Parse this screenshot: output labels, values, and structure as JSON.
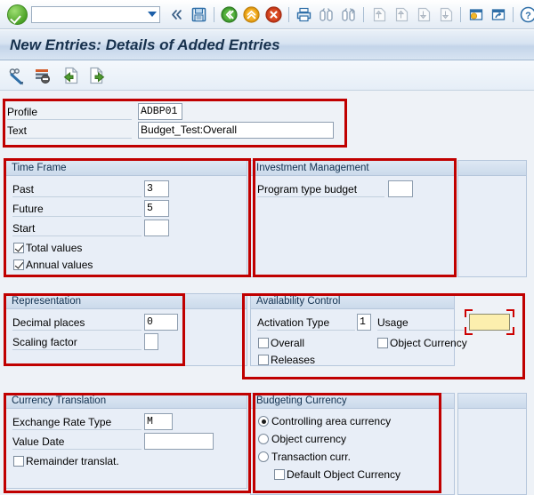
{
  "window": {
    "title": "New Entries: Details of Added Entries"
  },
  "toolbar": {
    "command_field": {
      "value": "",
      "placeholder": ""
    },
    "icons": [
      "enter-ok-icon",
      "dropdown-arrow-icon",
      "back-double-icon",
      "save-icon",
      "back-icon",
      "exit-up-icon",
      "cancel-icon",
      "print-icon",
      "find-icon",
      "find-next-icon",
      "first-page-icon",
      "previous-page-icon",
      "next-page-icon",
      "last-page-icon",
      "create-session-icon",
      "shortcut-icon",
      "help-icon",
      "customize-layout-icon"
    ]
  },
  "app_toolbar": {
    "icons": [
      "display-change-icon",
      "delete-entry-icon",
      "previous-entry-icon",
      "next-entry-icon"
    ]
  },
  "header_fields": {
    "profile_label": "Profile",
    "profile_value": "ADBP01",
    "text_label": "Text",
    "text_value": "Budget_Test:Overall"
  },
  "time_frame": {
    "title": "Time Frame",
    "past_label": "Past",
    "past_value": "3",
    "future_label": "Future",
    "future_value": "5",
    "start_label": "Start",
    "start_value": "",
    "total_values_label": "Total values",
    "total_values_checked": true,
    "annual_values_label": "Annual values",
    "annual_values_checked": true
  },
  "investment_management": {
    "title": "Investment Management",
    "program_type_budget_label": "Program type budget",
    "program_type_budget_value": ""
  },
  "representation": {
    "title": "Representation",
    "decimal_places_label": "Decimal places",
    "decimal_places_value": "0",
    "scaling_factor_label": "Scaling factor",
    "scaling_factor_value": ""
  },
  "availability_control": {
    "title": "Availability Control",
    "activation_type_label": "Activation Type",
    "activation_type_value": "1",
    "usage_label": "Usage",
    "usage_value": "",
    "overall_label": "Overall",
    "overall_checked": false,
    "releases_label": "Releases",
    "releases_checked": false,
    "object_currency_label": "Object Currency",
    "object_currency_checked": false
  },
  "currency_translation": {
    "title": "Currency Translation",
    "exchange_rate_type_label": "Exchange Rate Type",
    "exchange_rate_type_value": "M",
    "value_date_label": "Value Date",
    "value_date_value": "",
    "remainder_translat_label": "Remainder translat.",
    "remainder_translat_checked": false
  },
  "budgeting_currency": {
    "title": "Budgeting Currency",
    "selected": "Controlling area currency",
    "options": [
      {
        "label": "Controlling area currency",
        "selected": true
      },
      {
        "label": "Object currency",
        "selected": false
      },
      {
        "label": "Transaction curr.",
        "selected": false
      }
    ],
    "default_object_currency_label": "Default Object Currency",
    "default_object_currency_checked": false
  },
  "colors": {
    "annotation": "#c00000",
    "focus_field": "#fcefae",
    "panel_bg": "#e8eef7",
    "panel_header": "#cbdaeb",
    "title_text": "#17314d"
  }
}
